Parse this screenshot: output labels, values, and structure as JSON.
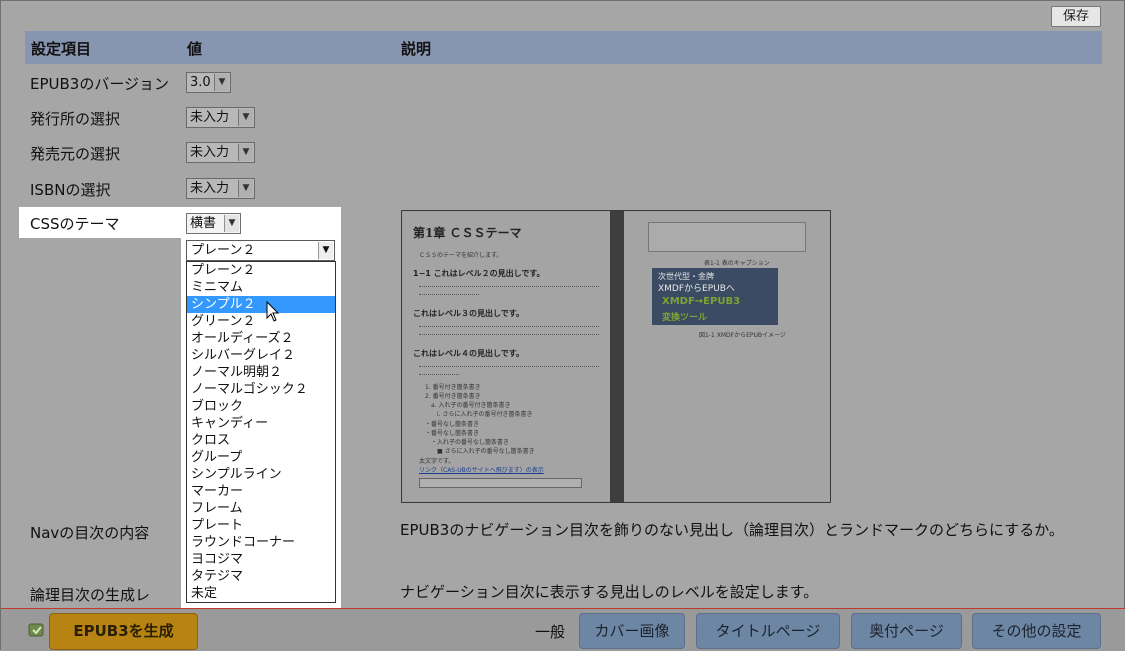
{
  "toolbar": {
    "save_label": "保存"
  },
  "table_header": {
    "col_item": "設定項目",
    "col_value": "値",
    "col_desc": "説明"
  },
  "rows": [
    {
      "label": "EPUB3のバージョン",
      "value": "3.0"
    },
    {
      "label": "発行所の選択",
      "value": "未入力"
    },
    {
      "label": "発売元の選択",
      "value": "未入力"
    },
    {
      "label": "ISBNの選択",
      "value": "未入力"
    },
    {
      "label": "CSSのテーマ",
      "value": "横書"
    },
    {
      "label": "Navの目次の内容",
      "value": "",
      "desc": "EPUB3のナビゲーション目次を飾りのない見出し（論理目次）とランドマークのどちらにするか。"
    },
    {
      "label": "論理目次の生成レ",
      "value": "",
      "desc": "ナビゲーション目次に表示する見出しのレベルを設定します。"
    }
  ],
  "theme_dropdown": {
    "current": "プレーン２",
    "selected_index": 2,
    "options": [
      "プレーン２",
      "ミニマム",
      "シンプル２",
      "グリーン２",
      "オールディーズ２",
      "シルバーグレイ２",
      "ノーマル明朝２",
      "ノーマルゴシック２",
      "ブロック",
      "キャンディー",
      "クロス",
      "グループ",
      "シンプルライン",
      "マーカー",
      "フレーム",
      "プレート",
      "ラウンドコーナー",
      "ヨコジマ",
      "タテジマ",
      "未定"
    ]
  },
  "preview": {
    "title": "第1章 ＣＳＳテーマ",
    "intro": "ＣＳＳのテーマを紹介します。",
    "h2": "1−1 これはレベル２の見出しです。",
    "h3": "これはレベル３の見出しです。",
    "h4": "これはレベル４の見出しです。",
    "list1": "1. 番号付き箇条書き",
    "list2": "2. 番号付き箇条書き",
    "nested1": "a. 入れ子の番号付き箇条書き",
    "nested2": "i. さらに入れ子の番号付き箇条書き",
    "bullet1": "・番号なし箇条書き",
    "bullet2": "・番号なし箇条書き",
    "bullet3": "・入れ子の番号なし箇条書き",
    "bullet4": "■ さらに入れ子の番号なし箇条書き",
    "bold": "太文字です。",
    "link": "リンク（CAS-UBのサイトへ飛びます）の表示",
    "caption": "表1-1 表のキャプション",
    "img_text1": "次世代型・金牌",
    "img_text2": "XMDFからEPUBへ",
    "img_text3": "XMDF→EPUB3",
    "img_text4": "変換ツール",
    "fig_caption": "図1-1 XMDFからEPUBイメージ"
  },
  "footer": {
    "generate_label": "EPUB3を生成",
    "section_label": "一般",
    "tabs": [
      "カバー画像",
      "タイトルページ",
      "奥付ページ",
      "その他の設定"
    ]
  },
  "colors": {
    "header": "#8795b0",
    "generate": "#b78413",
    "tab": "#6d86a3",
    "selected_option": "#3399ff"
  }
}
